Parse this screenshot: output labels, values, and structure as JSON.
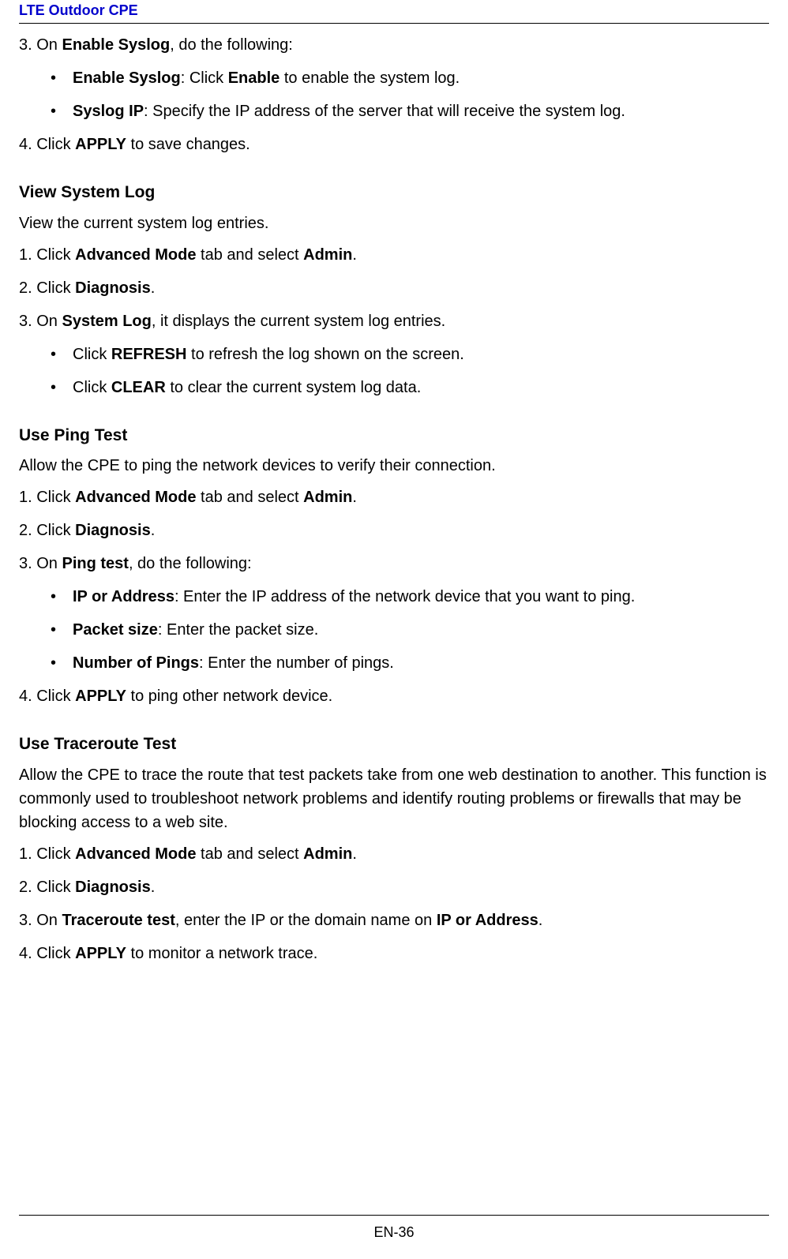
{
  "header": {
    "title": "LTE Outdoor CPE"
  },
  "section1": {
    "step3_prefix": "3. On ",
    "step3_bold": "Enable Syslog",
    "step3_suffix": ", do the following:",
    "bullet1_bold": "Enable Syslog",
    "bullet1_mid": ": Click ",
    "bullet1_bold2": "Enable",
    "bullet1_suffix": " to enable the system log.",
    "bullet2_bold": "Syslog IP",
    "bullet2_suffix": ": Specify the IP address of the server that will receive the system log.",
    "step4_prefix": "4. Click ",
    "step4_bold": "APPLY",
    "step4_suffix": " to save changes."
  },
  "section2": {
    "heading": "View System Log",
    "intro": "View the current system log entries.",
    "step1_prefix": "1. Click ",
    "step1_bold": "Advanced Mode",
    "step1_mid": " tab and select ",
    "step1_bold2": "Admin",
    "step1_suffix": ".",
    "step2_prefix": "2. Click ",
    "step2_bold": "Diagnosis",
    "step2_suffix": ".",
    "step3_prefix": "3. On ",
    "step3_bold": "System Log",
    "step3_suffix": ", it displays the current system log entries.",
    "bullet1_prefix": "Click ",
    "bullet1_bold": "REFRESH",
    "bullet1_suffix": " to refresh the log shown on the screen.",
    "bullet2_prefix": "Click ",
    "bullet2_bold": "CLEAR",
    "bullet2_suffix": " to clear the current system log data."
  },
  "section3": {
    "heading": "Use Ping Test",
    "intro": "Allow the CPE to ping the network devices to verify their connection.",
    "step1_prefix": "1. Click ",
    "step1_bold": "Advanced Mode",
    "step1_mid": " tab and select ",
    "step1_bold2": "Admin",
    "step1_suffix": ".",
    "step2_prefix": "2. Click ",
    "step2_bold": "Diagnosis",
    "step2_suffix": ".",
    "step3_prefix": "3. On ",
    "step3_bold": "Ping test",
    "step3_suffix": ", do the following:",
    "bullet1_bold": "IP or Address",
    "bullet1_suffix": ": Enter the IP address of the network device that you want to ping.",
    "bullet2_bold": "Packet size",
    "bullet2_suffix": ": Enter the packet size.",
    "bullet3_bold": "Number of Pings",
    "bullet3_suffix": ": Enter the number of pings.",
    "step4_prefix": "4. Click ",
    "step4_bold": "APPLY",
    "step4_suffix": " to ping other network device."
  },
  "section4": {
    "heading": "Use Traceroute Test",
    "intro": "Allow the CPE to trace the route that test packets take from one web destination to another. This function is commonly used to troubleshoot network problems and identify routing problems or firewalls that may be blocking access to a web site.",
    "step1_prefix": "1. Click ",
    "step1_bold": "Advanced Mode",
    "step1_mid": " tab and select ",
    "step1_bold2": "Admin",
    "step1_suffix": ".",
    "step2_prefix": "2. Click ",
    "step2_bold": "Diagnosis",
    "step2_suffix": ".",
    "step3_prefix": "3. On ",
    "step3_bold": "Traceroute test",
    "step3_mid": ", enter the IP or the domain name on ",
    "step3_bold2": "IP or Address",
    "step3_suffix": ".",
    "step4_prefix": "4. Click ",
    "step4_bold": "APPLY",
    "step4_suffix": " to monitor a network trace."
  },
  "footer": {
    "page": "EN-36"
  }
}
